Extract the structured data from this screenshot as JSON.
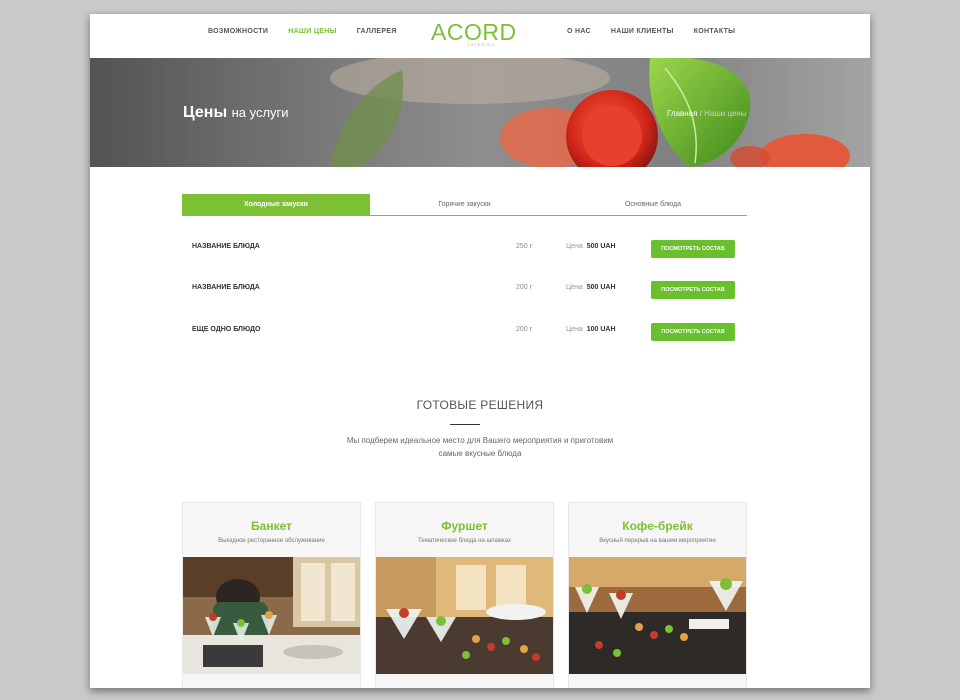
{
  "nav": {
    "left": [
      "Возможности",
      "Наши цены",
      "Галлерея"
    ],
    "right": [
      "О нас",
      "Наши клиенты",
      "Контакты"
    ],
    "active_index": 1
  },
  "logo": {
    "text": "ACORD",
    "sub": "CATERING"
  },
  "hero": {
    "title_bold": "Цены",
    "title_rest": "на услуги",
    "breadcrumb": {
      "home": "Главная",
      "sep": "/",
      "current": "Наши цены"
    }
  },
  "tabs": [
    "Холодные закуски",
    "Горячие закуски",
    "Основные блюда"
  ],
  "price_label": "Цена",
  "items": [
    {
      "name": "Название блюда",
      "weight": "250 г",
      "price": "500 UAH",
      "button": "Посмотреть состав"
    },
    {
      "name": "Название блюда",
      "weight": "200 г",
      "price": "500 UAH",
      "button": "Посмотреть состав"
    },
    {
      "name": "Еще одно блюдо",
      "weight": "200 г",
      "price": "100 UAH",
      "button": "Посмотреть состав"
    }
  ],
  "solutions": {
    "title": "ГОТОВЫЕ РЕШЕНИЯ",
    "desc_line1": "Мы подберем идеальное место для Вашего мероприятия и приготовим",
    "desc_line2": "самые вкусные блюда",
    "cards": [
      {
        "title": "Банкет",
        "subtitle": "Выездное ресторанное обслуживание"
      },
      {
        "title": "Фуршет",
        "subtitle": "Тематические блюда на шпажках"
      },
      {
        "title": "Кофе-брейк",
        "subtitle": "Вкусный перерыв на вашем мероприятии"
      }
    ]
  },
  "colors": {
    "accent": "#7dbf35",
    "button": "#6abf2e",
    "backdrop": "#c9c9c9"
  }
}
